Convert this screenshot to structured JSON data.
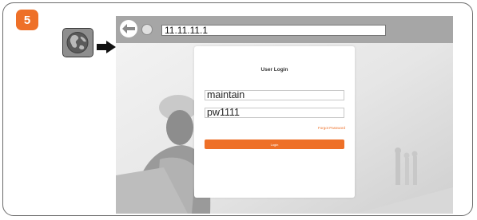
{
  "step": {
    "number": "5",
    "color": "#ee7028"
  },
  "icons": {
    "globe": "globe-icon",
    "arrow": "right-arrow-icon",
    "back": "back-arrow-icon",
    "reload": "reload-icon"
  },
  "browser": {
    "address": "11.11.11.1"
  },
  "login": {
    "title": "User Login",
    "username": "maintain",
    "password": "pw1111",
    "forgot": "Forgot Password",
    "button": "Login",
    "accent": "#ee7028"
  }
}
